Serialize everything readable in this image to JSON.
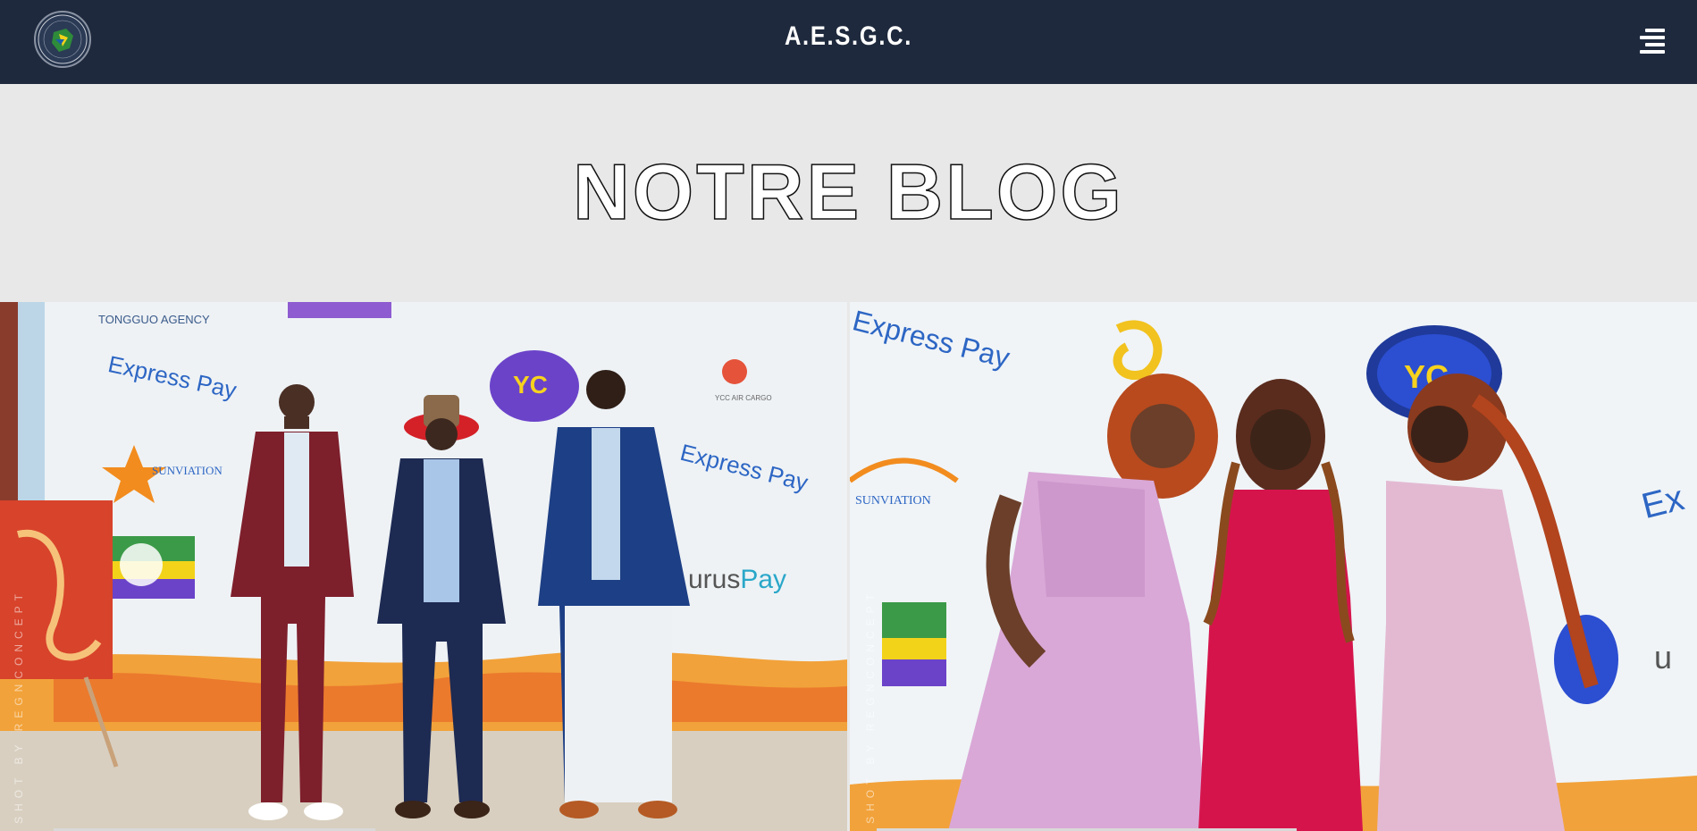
{
  "header": {
    "title": "A.E.S.G.C.",
    "logo_icon": "association-logo-icon",
    "menu_icon": "hamburger-menu-icon"
  },
  "page": {
    "title": "NOTRE BLOG"
  },
  "posts": [
    {
      "image": "group-photo-three-men",
      "credit": "SHOT BY REGNCONCEPT"
    },
    {
      "image": "group-photo-three-women",
      "credit": "SHOT BY REGNCONCEPT"
    }
  ],
  "colors": {
    "header_bg": "#1e293d",
    "page_bg": "#e8e8e8",
    "title_stroke": "#111111"
  }
}
